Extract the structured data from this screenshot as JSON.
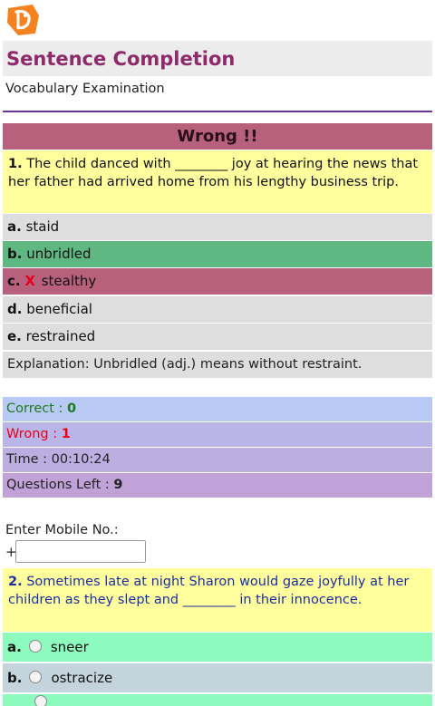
{
  "header": {
    "logo_icon": "butterfly-logo",
    "title": "Sentence Completion",
    "subtitle": "Vocabulary Examination"
  },
  "result": {
    "label": "Wrong !!"
  },
  "question1": {
    "number": "1.",
    "text": "The child danced with ________ joy at hearing the news that her father had arrived home from his lengthy business trip.",
    "options": [
      {
        "letter": "a.",
        "text": "staid"
      },
      {
        "letter": "b.",
        "text": "unbridled"
      },
      {
        "letter": "c.",
        "mark": "X",
        "text": "stealthy"
      },
      {
        "letter": "d.",
        "text": "beneficial"
      },
      {
        "letter": "e.",
        "text": "restrained"
      }
    ],
    "explanation": "Explanation: Unbridled (adj.) means without restraint."
  },
  "stats": {
    "correct_label": "Correct : ",
    "correct_value": "0",
    "wrong_label": "Wrong : ",
    "wrong_value": "1",
    "time_label": "Time : ",
    "time_value": "00:10:24",
    "left_label": "Questions Left : ",
    "left_value": "9"
  },
  "mobile": {
    "label": "Enter Mobile No.:",
    "prefix": "+",
    "value": ""
  },
  "question2": {
    "number": "2.",
    "text": "Sometimes late at night Sharon would gaze joyfully at her children as they slept and ________ in their innocence.",
    "options": [
      {
        "letter": "a.",
        "text": "sneer"
      },
      {
        "letter": "b.",
        "text": "ostracize"
      }
    ]
  },
  "colors": {
    "title": "#8e2a6a",
    "wrong_bar": "#b8617d",
    "correct_option": "#5fb882",
    "question_bg": "#ffff9e",
    "correct_text": "#1e7a1e",
    "wrong_text": "#e8001a"
  }
}
